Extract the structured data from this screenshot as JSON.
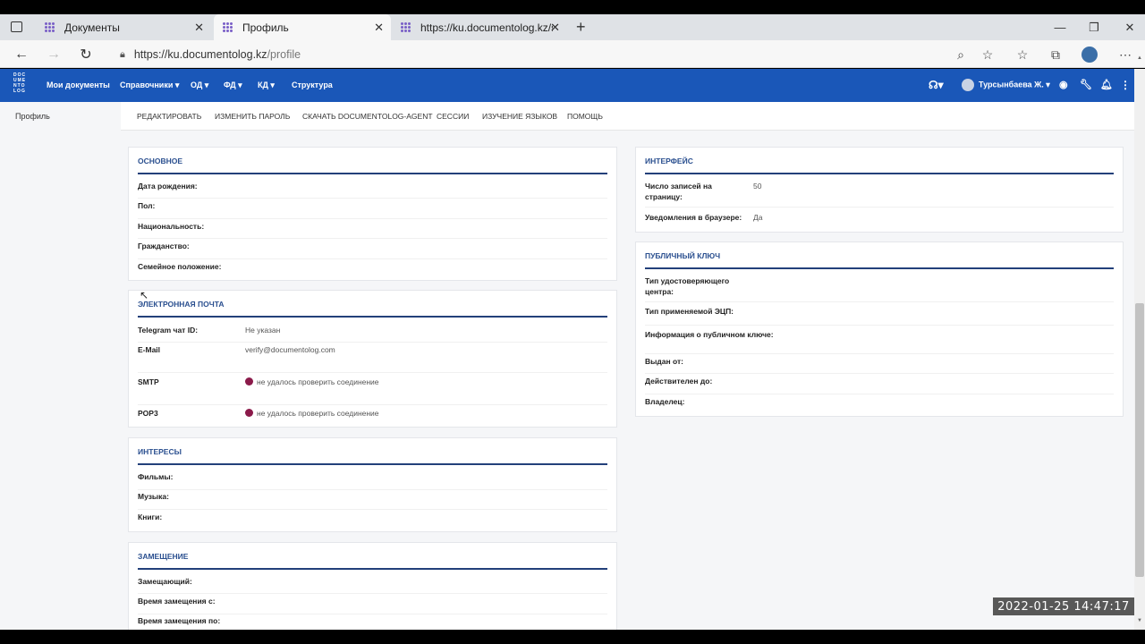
{
  "browser": {
    "tabs": [
      {
        "title": "Документы"
      },
      {
        "title": "Профиль"
      },
      {
        "title": "https://ku.documentolog.kz/sup"
      }
    ],
    "url_host": "https://ku.documentolog.kz",
    "url_path": "/profile"
  },
  "app": {
    "logo_text": "DOCUMENTOLOG",
    "nav": [
      "Мои документы",
      "Справочники ▾",
      "ОД ▾",
      "ФД ▾",
      "КД ▾",
      "Структура"
    ],
    "user": "Турсынбаева Ж. ▾",
    "sidebar_item": "Профиль",
    "subnav": [
      "РЕДАКТИРОВАТЬ",
      "ИЗМЕНИТЬ ПАРОЛЬ",
      "СКАЧАТЬ DOCUMENTOLOG-AGENT",
      "СЕССИИ",
      "ИЗУЧЕНИЕ ЯЗЫКОВ",
      "ПОМОЩЬ"
    ]
  },
  "cards": {
    "basic": {
      "title": "ОСНОВНОЕ",
      "rows": [
        "Дата рождения:",
        "Пол:",
        "Национальность:",
        "Гражданство:",
        "Семейное положение:"
      ]
    },
    "email": {
      "title": "ЭЛЕКТРОННАЯ ПОЧТА",
      "telegram_label": "Telegram чат ID:",
      "telegram_value": "Не указан",
      "email_label": "E-Mail",
      "email_value": "verify@documentolog.com",
      "smtp_label": "SMTP",
      "smtp_value": "не удалось проверить соединение",
      "pop3_label": "POP3",
      "pop3_value": "не удалось проверить соединение"
    },
    "interests": {
      "title": "ИНТЕРЕСЫ",
      "rows": [
        "Фильмы:",
        "Музыка:",
        "Книги:"
      ]
    },
    "substitution": {
      "title": "ЗАМЕЩЕНИЕ",
      "rows": [
        "Замещающий:",
        "Время замещения с:",
        "Время замещения по:"
      ]
    },
    "interface": {
      "title": "ИНТЕРФЕЙС",
      "per_page_label": "Число записей на страницу:",
      "per_page_value": "50",
      "notify_label": "Уведомления в браузере:",
      "notify_value": "Да"
    },
    "pubkey": {
      "title": "ПУБЛИЧНЫЙ КЛЮЧ",
      "rows": [
        "Тип удостоверяющего центра:",
        "Тип применяемой ЭЦП:",
        "Информация о публичном ключе:",
        "Выдан от:",
        "Действителен до:",
        "Владелец:"
      ]
    }
  },
  "timestamp": "2022-01-25  14:47:17",
  "colors": {
    "nav_bg": "#1a57b8",
    "status_dot": "#8b1a4a",
    "section_title": "#2a4f8f"
  }
}
